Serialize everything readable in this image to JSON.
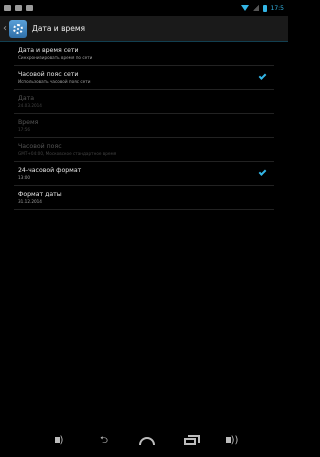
{
  "status_bar": {
    "time": "17:5"
  },
  "action_bar": {
    "title": "Дата и время"
  },
  "settings": [
    {
      "title": "Дата и время сети",
      "summary": "Синхронизировать время по сети",
      "checked": false,
      "enabled": true
    },
    {
      "title": "Часовой пояс сети",
      "summary": "Использовать часовой пояс сети",
      "checked": true,
      "enabled": true
    },
    {
      "title": "Дата",
      "summary": "24.03.2014",
      "checked": false,
      "enabled": false
    },
    {
      "title": "Время",
      "summary": "17:56",
      "checked": false,
      "enabled": false
    },
    {
      "title": "Часовой пояс",
      "summary": "GMT+04:00, Московское стандартное время",
      "checked": false,
      "enabled": false
    },
    {
      "title": "24-часовой формат",
      "summary": "13:00",
      "checked": true,
      "enabled": true
    },
    {
      "title": "Формат даты",
      "summary": "31.12.2014",
      "checked": false,
      "enabled": true
    }
  ]
}
